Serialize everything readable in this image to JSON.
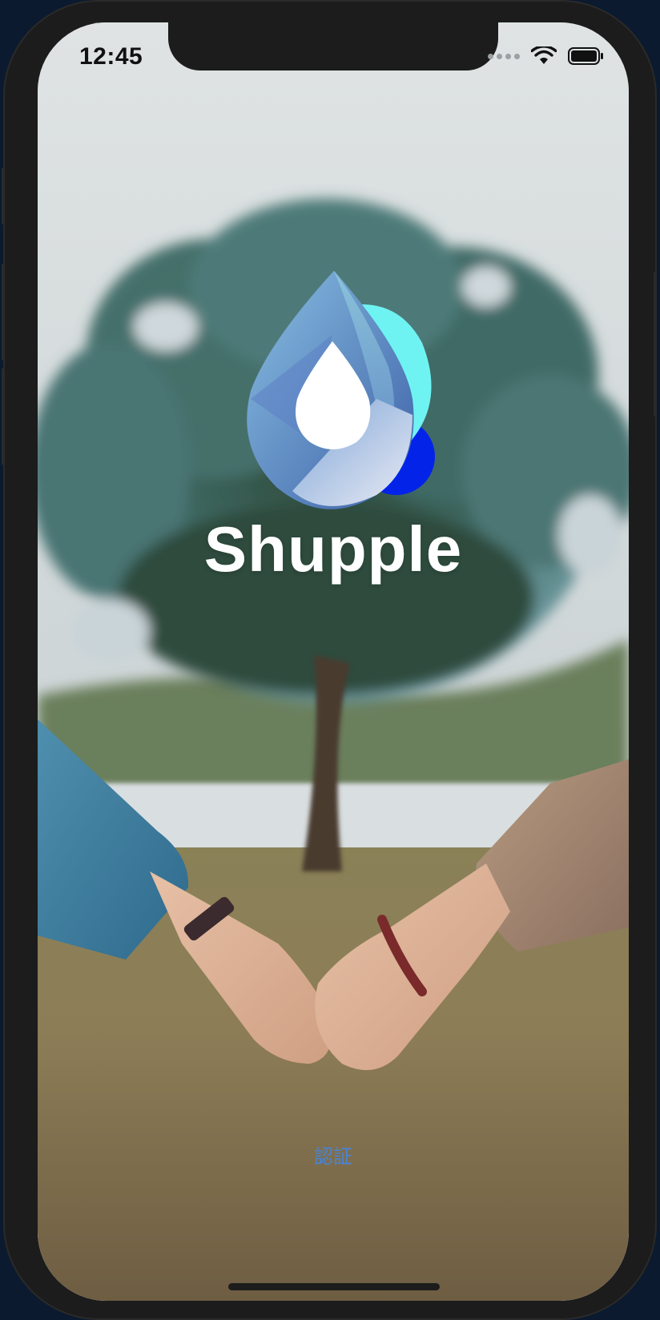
{
  "status_bar": {
    "time": "12:45",
    "icons": [
      "signal-icon",
      "wifi-icon",
      "battery-icon"
    ]
  },
  "splash": {
    "app_name": "Shupple",
    "auth_link": "認証"
  },
  "colors": {
    "brand_cyan": "#6ff3f2",
    "brand_blue": "#0324e8",
    "brand_steel": "#5f87c7",
    "link_blue": "#4a84d4"
  }
}
